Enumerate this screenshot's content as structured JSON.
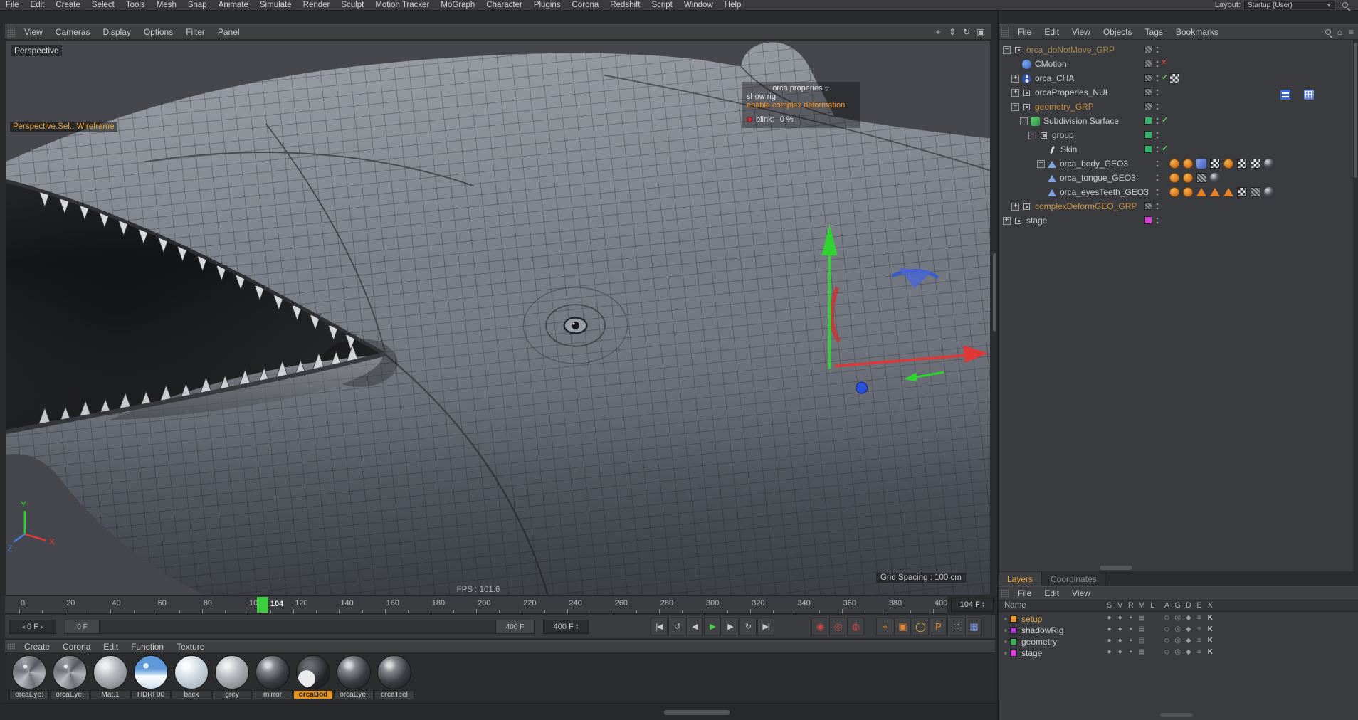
{
  "menubar": {
    "items": [
      "File",
      "Edit",
      "Create",
      "Select",
      "Tools",
      "Mesh",
      "Snap",
      "Animate",
      "Simulate",
      "Render",
      "Sculpt",
      "Motion Tracker",
      "MoGraph",
      "Character",
      "Plugins",
      "Corona",
      "Redshift",
      "Script",
      "Window",
      "Help"
    ],
    "layout_label": "Layout:",
    "layout_value": "Startup (User)"
  },
  "viewport": {
    "menu": [
      "View",
      "Cameras",
      "Display",
      "Options",
      "Filter",
      "Panel"
    ],
    "nav_icons": [
      {
        "name": "pan-view-icon",
        "glyph": "+"
      },
      {
        "name": "zoom-view-icon",
        "glyph": "⇕"
      },
      {
        "name": "rotate-view-icon",
        "glyph": "↻"
      },
      {
        "name": "toggle-view-icon",
        "glyph": "▣"
      }
    ],
    "view_label": "Perspective",
    "selection_label": "Perspective.Sel.: Wireframe",
    "fps_label": "FPS : 101.6",
    "grid_label": "Grid Spacing : 100 cm",
    "hud": {
      "title": "orca properies",
      "show_rig": "show rig",
      "deform": "enable complex deformation",
      "blink_label": "blink:",
      "blink_value": "0 %"
    },
    "axis": {
      "x": "X",
      "y": "Y",
      "z": "Z"
    }
  },
  "timeline": {
    "ticks": [
      0,
      20,
      40,
      60,
      80,
      100,
      120,
      140,
      160,
      180,
      200,
      220,
      240,
      260,
      280,
      300,
      320,
      340,
      360,
      380,
      400
    ],
    "max_frame": 400,
    "current_frame": 104,
    "current_frame_label": "104",
    "frame_value": "104 F"
  },
  "anim": {
    "range_start": "0 F",
    "slider_start": "0 F",
    "slider_end": "400 F",
    "end_value": "400 F",
    "transport": [
      {
        "name": "goto-start-button",
        "glyph": "|◀"
      },
      {
        "name": "previous-key-button",
        "glyph": "↺"
      },
      {
        "name": "previous-frame-button",
        "glyph": "◀"
      },
      {
        "name": "play-button",
        "glyph": "▶",
        "color": "#45d045"
      },
      {
        "name": "next-frame-button",
        "glyph": "▶"
      },
      {
        "name": "next-key-button",
        "glyph": "↻"
      },
      {
        "name": "goto-end-button",
        "glyph": "▶|"
      }
    ],
    "records": [
      {
        "name": "record-keyframe-button",
        "glyph": "◉",
        "color": "#d04545"
      },
      {
        "name": "autokey-button",
        "glyph": "◎",
        "color": "#d04545"
      },
      {
        "name": "keyframe-selection-button",
        "glyph": "◍",
        "color": "#d04545"
      },
      {
        "name": "record-position-button",
        "glyph": "+",
        "color": "#e8882a",
        "gap": true
      },
      {
        "name": "record-scale-button",
        "glyph": "▣",
        "color": "#e8882a"
      },
      {
        "name": "record-rotation-button",
        "glyph": "◯",
        "color": "#e8b83a"
      },
      {
        "name": "record-parameter-button",
        "glyph": "P",
        "color": "#e8882a"
      },
      {
        "name": "record-pla-button",
        "glyph": "∷",
        "color": "#b0b0b0"
      },
      {
        "name": "snap-settings-button",
        "glyph": "▦",
        "color": "#7d9ce8"
      }
    ]
  },
  "materials": {
    "menu": [
      "Create",
      "Corona",
      "Edit",
      "Function",
      "Texture"
    ],
    "items": [
      {
        "label": "orcaEye:",
        "style": "eye",
        "selected": false
      },
      {
        "label": "orcaEye:",
        "style": "eye",
        "selected": false
      },
      {
        "label": "Mat.1",
        "style": "gray",
        "selected": false
      },
      {
        "label": "HDRI 00",
        "style": "sky",
        "selected": false
      },
      {
        "label": "back",
        "style": "pale",
        "selected": false
      },
      {
        "label": "grey",
        "style": "gray",
        "selected": false
      },
      {
        "label": "mirror",
        "style": "dark",
        "selected": false
      },
      {
        "label": "orcaBod",
        "style": "orca",
        "selected": true
      },
      {
        "label": "orcaEye:",
        "style": "dark",
        "selected": false
      },
      {
        "label": "orcaTeel",
        "style": "dark",
        "selected": false
      }
    ]
  },
  "object_manager": {
    "menu": [
      "File",
      "Edit",
      "View",
      "Objects",
      "Tags",
      "Bookmarks"
    ],
    "right_icons": [
      {
        "name": "search-icon",
        "type": "mag"
      },
      {
        "name": "home-icon",
        "glyph": "⌂"
      },
      {
        "name": "panel-menu-icon",
        "glyph": "≡"
      }
    ],
    "tree": [
      {
        "label": "orca_doNotMove_GRP",
        "indent": 0,
        "expander": "minus",
        "icon": "null",
        "color": "#a38a4f",
        "layer": "hatch",
        "status": "",
        "tags": []
      },
      {
        "label": "CMotion",
        "indent": 1,
        "expander": "",
        "icon": "cmotion",
        "color": "#cdced1",
        "layer": "hatch",
        "status": "cross",
        "tags": []
      },
      {
        "label": "orca_CHA",
        "indent": 1,
        "expander": "plus",
        "icon": "character",
        "color": "#cdced1",
        "layer": "hatch",
        "status": "check",
        "tags": [
          "checker"
        ]
      },
      {
        "label": "orcaProperies_NUL",
        "indent": 1,
        "expander": "plus",
        "icon": "null",
        "color": "#cdced1",
        "layer": "hatch",
        "status": "",
        "tags": [
          "sliders",
          "bluegrid"
        ]
      },
      {
        "label": "geometry_GRP",
        "indent": 1,
        "expander": "minus",
        "icon": "null",
        "color": "#c89143",
        "layer": "hatch",
        "status": "",
        "tags": []
      },
      {
        "label": "Subdivision Surface",
        "indent": 2,
        "expander": "minus",
        "icon": "subd",
        "color": "#cdced1",
        "layer": "green",
        "status": "check",
        "tags": []
      },
      {
        "label": "group",
        "indent": 3,
        "expander": "minus",
        "icon": "null",
        "color": "#cdced1",
        "layer": "green",
        "status": "",
        "tags": []
      },
      {
        "label": "Skin",
        "indent": 4,
        "expander": "",
        "icon": "skin",
        "color": "#cdced1",
        "layer": "green",
        "status": "check",
        "tags": []
      },
      {
        "label": "orca_body_GEO3",
        "indent": 4,
        "expander": "plus",
        "icon": "poly",
        "color": "#cdced1",
        "layer": "",
        "status": "",
        "tags": [
          "dot",
          "dot",
          "flag",
          "checker",
          "dot",
          "checker",
          "checker",
          "sphere"
        ]
      },
      {
        "label": "orca_tongue_GEO3",
        "indent": 4,
        "expander": "",
        "icon": "poly",
        "color": "#cdced1",
        "layer": "",
        "status": "",
        "tags": [
          "dot",
          "dot",
          "hatch",
          "sphere"
        ]
      },
      {
        "label": "orca_eyesTeeth_GEO3",
        "indent": 4,
        "expander": "",
        "icon": "poly",
        "color": "#cdced1",
        "layer": "",
        "status": "",
        "tags": [
          "dot",
          "dot",
          "tri",
          "tri",
          "tri",
          "checker",
          "hatch",
          "sphere"
        ]
      },
      {
        "label": "complexDeformGEO_GRP",
        "indent": 1,
        "expander": "plus",
        "icon": "null",
        "color": "#c89143",
        "layer": "hatch",
        "status": "",
        "tags": []
      },
      {
        "label": "stage",
        "indent": 0,
        "expander": "plus",
        "icon": "null",
        "color": "#cdced1",
        "layer": "magenta",
        "status": "",
        "tags": []
      }
    ]
  },
  "layers_panel": {
    "tabs": [
      {
        "label": "Layers",
        "active": true
      },
      {
        "label": "Coordinates",
        "active": false
      }
    ],
    "menu": [
      "File",
      "Edit",
      "View"
    ],
    "name_header": "Name",
    "columns": [
      "S",
      "V",
      "R",
      "M",
      "L",
      "A",
      "G",
      "D",
      "E",
      "X"
    ],
    "cell_glyphs": [
      "●",
      "●",
      "▪",
      "▤",
      "",
      "◇",
      "◎",
      "◆",
      "≡",
      "K"
    ],
    "rows": [
      {
        "name": "setup",
        "color": "#e8962e",
        "text_color": "#e0b050"
      },
      {
        "name": "shadowRig",
        "color": "#a43ecb",
        "text_color": "#cdced1"
      },
      {
        "name": "geometry",
        "color": "#3fae58",
        "text_color": "#cdced1"
      },
      {
        "name": "stage",
        "color": "#d63ed6",
        "text_color": "#cdced1"
      }
    ]
  }
}
